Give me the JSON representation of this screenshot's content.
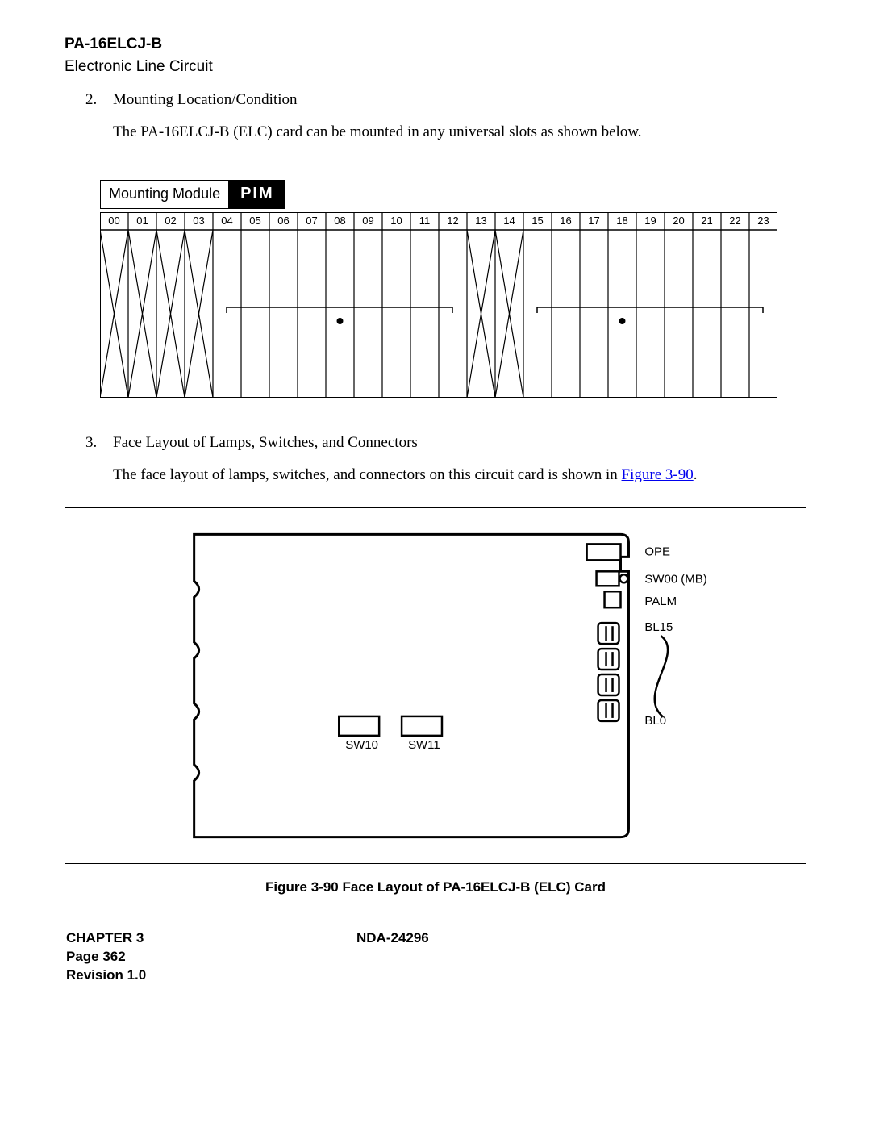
{
  "header": {
    "code": "PA-16ELCJ-B",
    "sub": "Electronic Line Circuit"
  },
  "section2": {
    "num": "2.",
    "title": "Mounting Location/Condition",
    "body": "The PA-16ELCJ-B (ELC) card can be mounted in any universal slots as shown below."
  },
  "mounting": {
    "label": "Mounting Module",
    "pim": "PIM",
    "slots": [
      "00",
      "01",
      "02",
      "03",
      "04",
      "05",
      "06",
      "07",
      "08",
      "09",
      "10",
      "11",
      "12",
      "13",
      "14",
      "15",
      "16",
      "17",
      "18",
      "19",
      "20",
      "21",
      "22",
      "23"
    ]
  },
  "section3": {
    "num": "3.",
    "title": "Face Layout of Lamps, Switches, and Connectors",
    "body_a": "The face layout of lamps, switches, and connectors on this circuit card is shown in ",
    "body_link": "Figure 3-90",
    "body_b": "."
  },
  "card": {
    "labels": {
      "ope": "OPE",
      "sw00": "SW00 (MB)",
      "palm": "PALM",
      "bl15": "BL15",
      "bl0": "BL0",
      "sw10": "SW10",
      "sw11": "SW11"
    }
  },
  "figure_caption": "Figure 3-90   Face Layout of PA-16ELCJ-B (ELC) Card",
  "footer": {
    "chapter": "CHAPTER 3",
    "doc": "NDA-24296",
    "page": "Page 362",
    "rev": "Revision 1.0"
  },
  "chart_data": {
    "type": "table",
    "title": "PIM Mounting Module slot occupancy",
    "columns": [
      "slot",
      "crossed_out",
      "has_dot"
    ],
    "rows": [
      [
        "00",
        true,
        false
      ],
      [
        "01",
        true,
        false
      ],
      [
        "02",
        true,
        false
      ],
      [
        "03",
        true,
        false
      ],
      [
        "04",
        false,
        false
      ],
      [
        "05",
        false,
        false
      ],
      [
        "06",
        false,
        false
      ],
      [
        "07",
        false,
        false
      ],
      [
        "08",
        false,
        true
      ],
      [
        "09",
        false,
        false
      ],
      [
        "10",
        false,
        false
      ],
      [
        "11",
        false,
        false
      ],
      [
        "12",
        false,
        false
      ],
      [
        "13",
        true,
        false
      ],
      [
        "14",
        true,
        false
      ],
      [
        "15",
        false,
        false
      ],
      [
        "16",
        false,
        false
      ],
      [
        "17",
        false,
        false
      ],
      [
        "18",
        false,
        true
      ],
      [
        "19",
        false,
        false
      ],
      [
        "20",
        false,
        false
      ],
      [
        "21",
        false,
        false
      ],
      [
        "22",
        false,
        false
      ],
      [
        "23",
        false,
        false
      ]
    ]
  }
}
